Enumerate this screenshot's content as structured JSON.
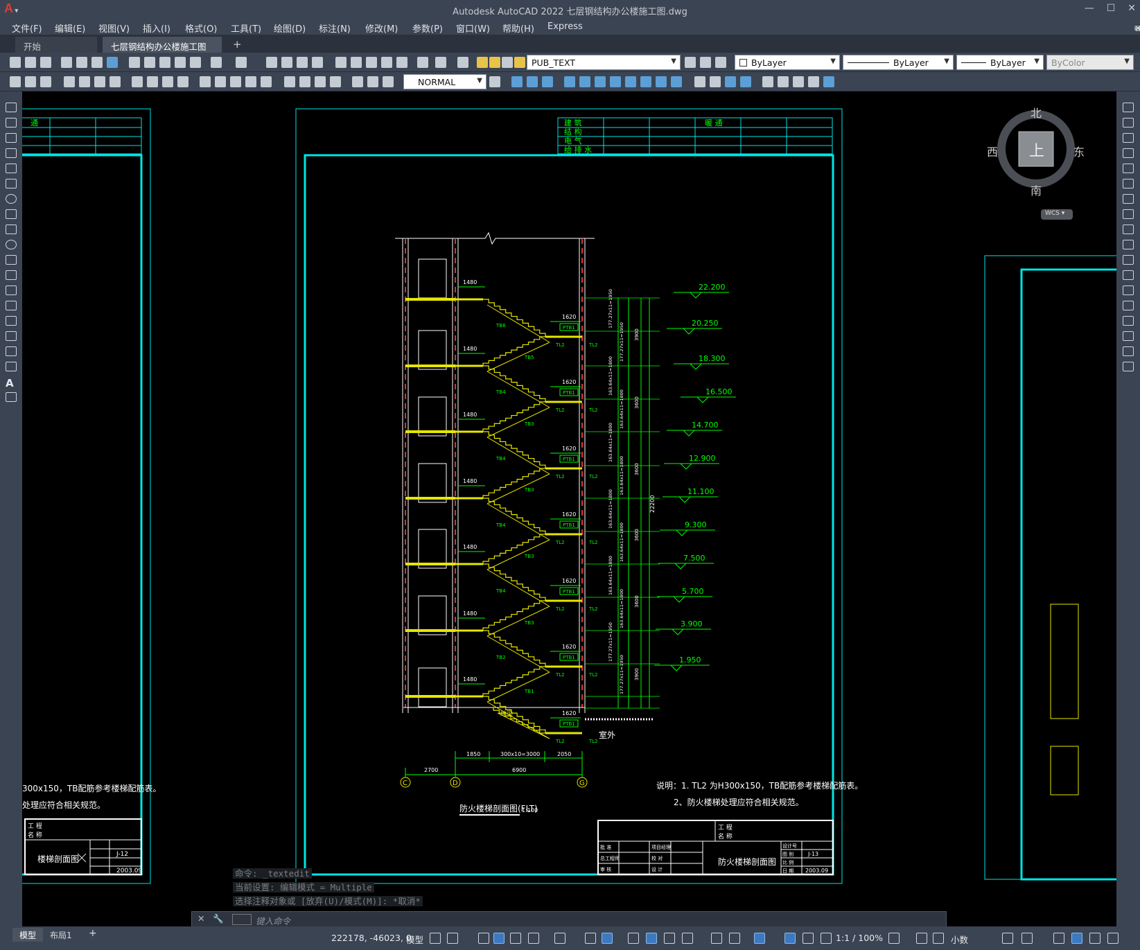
{
  "window": {
    "title": "Autodesk AutoCAD 2022    七层钢结构办公楼施工图.dwg",
    "logo": "A",
    "buttons": [
      "—",
      "☐",
      "✕"
    ],
    "mdi_buttons": [
      "—",
      "⧉",
      "✕"
    ]
  },
  "menu": [
    "文件(F)",
    "编辑(E)",
    "视图(V)",
    "插入(I)",
    "格式(O)",
    "工具(T)",
    "绘图(D)",
    "标注(N)",
    "修改(M)",
    "参数(P)",
    "窗口(W)",
    "帮助(H)",
    "Express"
  ],
  "tabs": {
    "start": "开始",
    "document": "七层钢结构办公楼施工图*",
    "close": "✕",
    "add": "+"
  },
  "toolbar": {
    "layer": "PUB_TEXT",
    "color": "ByLayer",
    "linetype": "ByLayer",
    "lineweight": "ByLayer",
    "plotstyle": "ByColor",
    "dimstyle": "NORMAL"
  },
  "viewcube": {
    "north": "北",
    "south": "南",
    "east": "东",
    "west": "西",
    "top": "上",
    "wcs": "WCS"
  },
  "drawing": {
    "left_sheet": {
      "header_cell": "通",
      "note1": "300x150，TB配筋参考楼梯配筋表。",
      "note2": "处理应符合相关规范。",
      "title_rows": [
        "工 程",
        "名 称"
      ],
      "sheet_name": "楼梯剖面图",
      "sheet_no": "J-12",
      "date": "2003.09"
    },
    "disciplines": [
      "建  筑",
      "结  构",
      "电  气",
      "给 排 水"
    ],
    "header_right": "暖   通",
    "elevations": [
      "22.200",
      "20.250",
      "18.300",
      "16.500",
      "14.700",
      "12.900",
      "11.100",
      "9.300",
      "7.500",
      "5.700",
      "3.900",
      "1.950"
    ],
    "landings": [
      "1480",
      "1620"
    ],
    "beam_labels": [
      "TL2",
      "PTB1"
    ],
    "flight_labels": [
      "TB6",
      "TB5",
      "TB4",
      "TB3",
      "TB4",
      "TB3",
      "TB4",
      "TB3",
      "TB4",
      "TB3",
      "TB2",
      "TB1"
    ],
    "vertical_dims": [
      "177.27x11=1950",
      "177.27x11=1950",
      "163.64x11=1800",
      "163.64x11=1800",
      "163.64x11=1800",
      "163.64x11=1800",
      "163.64x11=1800",
      "163.64x11=1800",
      "163.64x11=1800",
      "163.64x11=1800",
      "177.27x11=1950",
      "177.27x11=1950"
    ],
    "floor_heights": [
      "3900",
      "3600",
      "3600",
      "3600",
      "3600",
      "3900"
    ],
    "total_height": "22200",
    "ground_label": "地梁",
    "outside_label": "室外",
    "horizontal_dims": {
      "left": "1850",
      "mid": "300x10=3000",
      "right": "2050",
      "bay_left": "2700",
      "bay_total": "6900"
    },
    "axes": [
      "C",
      "D",
      "G"
    ],
    "drawing_title": "防火楼梯剖面图(FLT)",
    "scale": "1:100",
    "notes": [
      "说明：1. TL2 为H300x150，TB配筋参考楼梯配筋表。",
      "2、防火楼梯处理应符合相关规范。"
    ],
    "titleblock": {
      "rows": [
        "工 程",
        "名 称"
      ],
      "left_labels": [
        "批  准",
        "总工程师",
        "审  核"
      ],
      "mid_labels": [
        "项目经理",
        "校  对",
        "设  计"
      ],
      "sheet_name": "防火楼梯剖面图",
      "right_labels": [
        "设计号",
        "图  别",
        "比  例",
        "日  期"
      ],
      "sheet_no": "J-13",
      "date": "2003.09"
    }
  },
  "command": {
    "history": [
      "命令: _textedit",
      "当前设置: 编辑模式 = Multiple",
      "选择注释对象或 [放弃(U)/模式(M)]: *取消*"
    ],
    "placeholder": "键入命令"
  },
  "status": {
    "model_tab": "模型",
    "layout_tab": "布局1",
    "add": "+",
    "coords": "222178, -46023, 0",
    "space": "模型",
    "scale": "1:1 / 100%",
    "units": "小数"
  }
}
